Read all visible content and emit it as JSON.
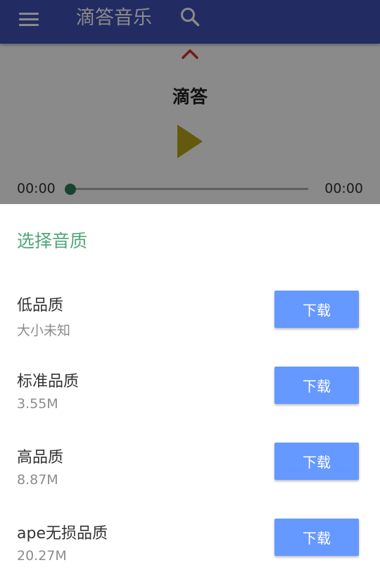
{
  "app_bar": {
    "title": "滴答音乐",
    "menu_icon": "menu-icon",
    "search_icon": "search-icon",
    "color": "#3f51b5"
  },
  "player": {
    "song_title": "滴答",
    "current_time": "00:00",
    "total_time": "00:00",
    "progress": 0,
    "play_icon": "play-icon",
    "play_color": "#b8a61b",
    "collapse_icon": "chevron-up-icon",
    "collapse_color": "#d32f2f"
  },
  "sheet": {
    "title": "选择音质",
    "title_color": "#52a57a",
    "button_color": "#6699ff",
    "options": [
      {
        "name": "低品质",
        "size": "大小未知",
        "button": "下载"
      },
      {
        "name": "标准品质",
        "size": "3.55M",
        "button": "下载"
      },
      {
        "name": "高品质",
        "size": "8.87M",
        "button": "下载"
      },
      {
        "name": "ape无损品质",
        "size": "20.27M",
        "button": "下载"
      }
    ]
  }
}
